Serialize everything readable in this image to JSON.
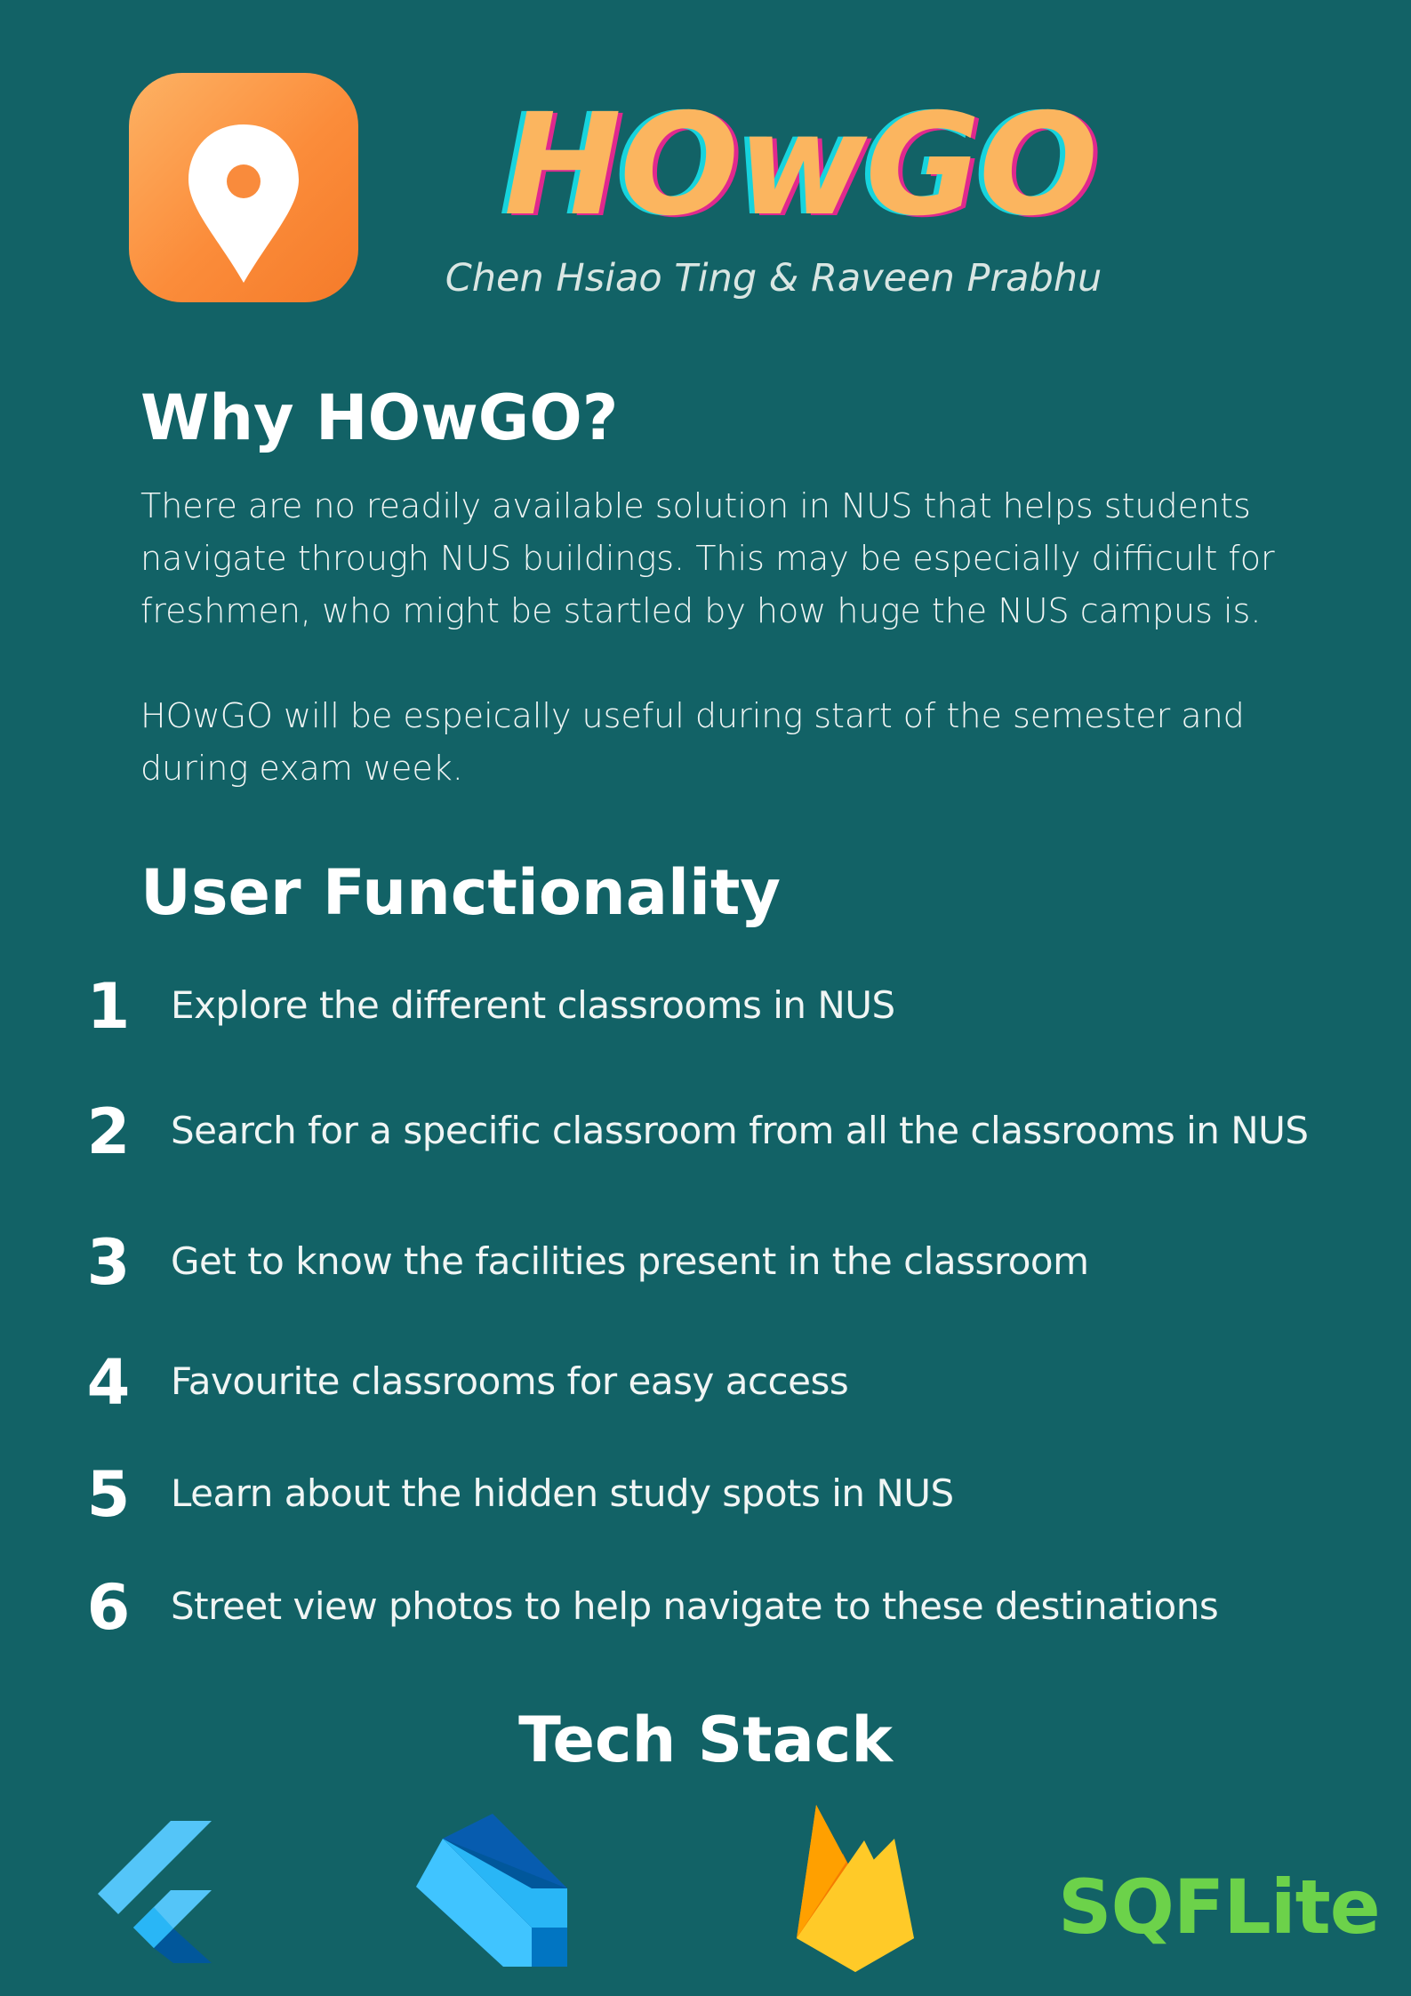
{
  "header": {
    "app_name": "HOwGO",
    "authors": "Chen Hsiao Ting & Raveen Prabhu",
    "app_icon": "location-pin-icon"
  },
  "why": {
    "heading": "Why HOwGO?",
    "paragraph_1": "There are no readily available solution in NUS that helps students navigate through NUS buildings. This may be especially difficult for freshmen, who might be startled by how huge the NUS campus is.",
    "paragraph_2": "HOwGO will be espeically useful during start of the semester and during exam week."
  },
  "functionality": {
    "heading": "User Functionality",
    "items": [
      {
        "number": "1",
        "text": "Explore the different classrooms in NUS"
      },
      {
        "number": "2",
        "text": "Search for a specific classroom from all the classrooms in NUS"
      },
      {
        "number": "3",
        "text": "Get to know the facilities present in the classroom"
      },
      {
        "number": "4",
        "text": "Favourite classrooms for easy access"
      },
      {
        "number": "5",
        "text": "Learn about the hidden study spots in NUS"
      },
      {
        "number": "6",
        "text": "Street view photos to help navigate to these destinations"
      }
    ]
  },
  "tech_stack": {
    "heading": "Tech Stack",
    "logos": [
      "flutter-logo",
      "dart-logo",
      "firebase-logo",
      "sqflite-logo"
    ],
    "sqflite_label": "SQFLite"
  },
  "colors": {
    "background": "#126266",
    "title": "#fbb55f",
    "icon_gradient_start": "#fdb264",
    "icon_gradient_end": "#f57b2a",
    "sqflite_green": "#6cd24a"
  }
}
